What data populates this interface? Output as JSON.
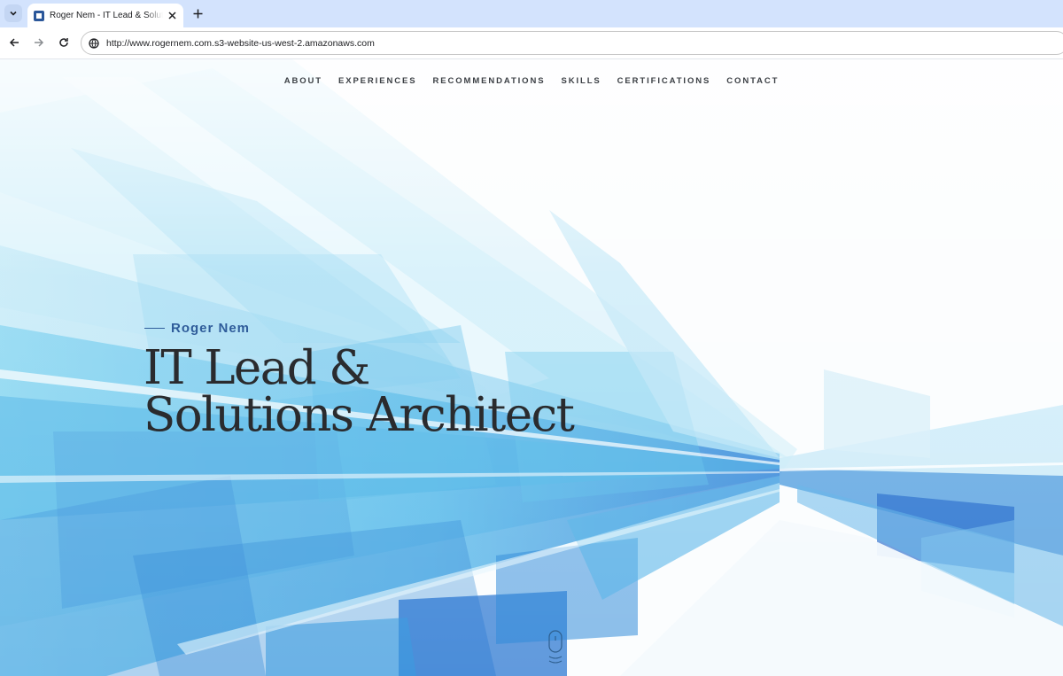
{
  "browser": {
    "tab_title": "Roger Nem - IT Lead & Solutions Architect",
    "url": "http://www.rogernem.com.s3-website-us-west-2.amazonaws.com"
  },
  "site": {
    "nav": [
      "ABOUT",
      "EXPERIENCES",
      "RECOMMENDATIONS",
      "SKILLS",
      "CERTIFICATIONS",
      "CONTACT"
    ],
    "kicker": "Roger Nem",
    "title_line1": "IT Lead &",
    "title_line2": "Solutions Architect"
  },
  "colors": {
    "accent": "#2f5c9a",
    "heading": "#2a2b2e",
    "tab_strip": "#d3e3fd"
  },
  "icons": {
    "tab_search": "chevron-down-icon",
    "favicon": "site-favicon",
    "close": "close-icon",
    "new_tab": "plus-icon",
    "back": "back-arrow-icon",
    "forward": "forward-arrow-icon",
    "reload": "reload-icon",
    "site_info": "globe-icon",
    "scroll": "mouse-scroll-icon"
  }
}
